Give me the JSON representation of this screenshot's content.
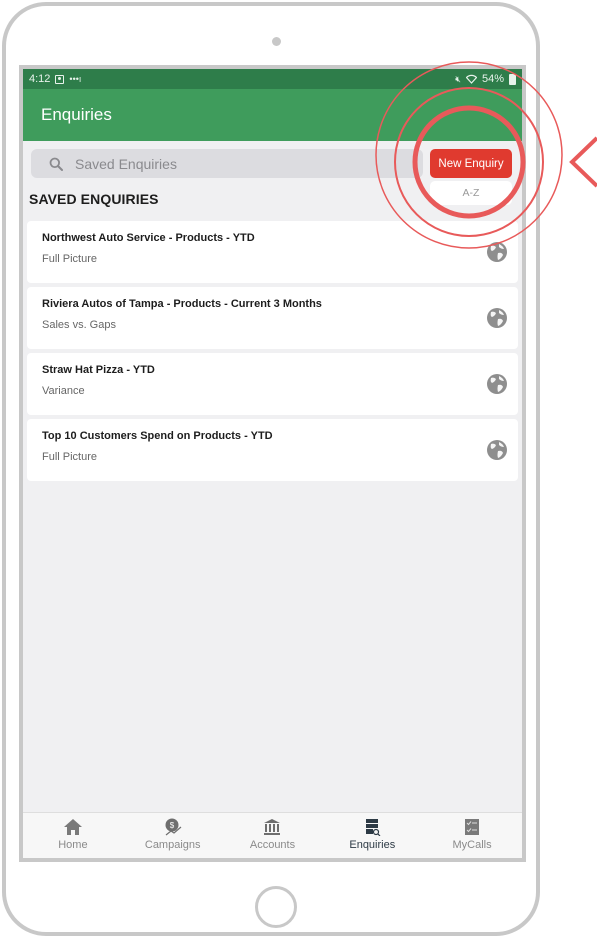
{
  "status_bar": {
    "time": "4:12",
    "signal_dots": "•••ı",
    "battery": "54%"
  },
  "header": {
    "title": "Enquiries"
  },
  "toolbar": {
    "search_placeholder": "Saved Enquiries",
    "new_enquiry_label": "New Enquiry",
    "sort_label": "A-Z"
  },
  "section": {
    "title": "SAVED ENQUIRIES"
  },
  "enquiries": [
    {
      "title": "Northwest Auto Service - Products - YTD",
      "subtitle": "Full Picture",
      "icon": "globe-icon"
    },
    {
      "title": "Riviera Autos of Tampa - Products - Current 3 Months",
      "subtitle": "Sales vs. Gaps",
      "icon": "globe-icon"
    },
    {
      "title": "Straw Hat Pizza - YTD",
      "subtitle": "Variance",
      "icon": "globe-icon"
    },
    {
      "title": "Top 10 Customers Spend on Products - YTD",
      "subtitle": "Full Picture",
      "icon": "globe-icon"
    }
  ],
  "tabs": [
    {
      "label": "Home",
      "icon": "home-icon",
      "active": false
    },
    {
      "label": "Campaigns",
      "icon": "campaigns-icon",
      "active": false
    },
    {
      "label": "Accounts",
      "icon": "bank-icon",
      "active": false
    },
    {
      "label": "Enquiries",
      "icon": "enquiries-icon",
      "active": true
    },
    {
      "label": "MyCalls",
      "icon": "checklist-icon",
      "active": false
    }
  ],
  "colors": {
    "status_bar": "#2e7d4a",
    "header": "#3f9c5c",
    "primary_button": "#e03a2f",
    "annotation": "#e85a5a",
    "background": "#f0f0f2"
  }
}
